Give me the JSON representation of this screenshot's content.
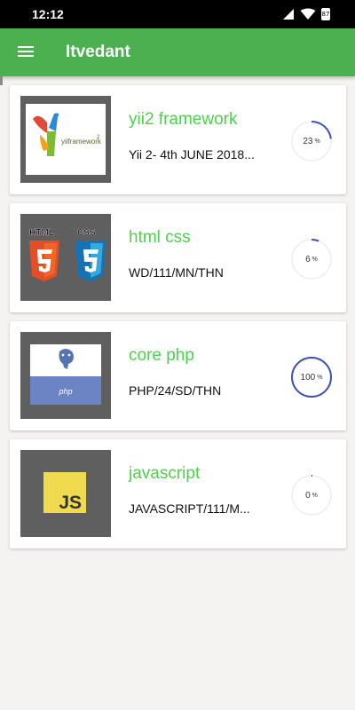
{
  "status_bar": {
    "time": "12:12",
    "battery": "87"
  },
  "app_bar": {
    "title": "Itvedant"
  },
  "colors": {
    "accent": "#4caf50",
    "title_green": "#4cd14c",
    "progress": "#3f51b5"
  },
  "courses": [
    {
      "title": "yii2 framework",
      "code": "Yii 2- 4th JUNE 2018...",
      "progress": 23,
      "unit": "%",
      "icon": "yii-framework-logo",
      "logo_text": "yiiframework"
    },
    {
      "title": "html css",
      "code": "WD/111/MN/THN",
      "progress": 6,
      "unit": "%",
      "icon": "html5-css3-logo",
      "logo_html": "HTML",
      "logo_css": "CSS"
    },
    {
      "title": "core php",
      "code": "PHP/24/SD/THN",
      "progress": 100,
      "unit": "%",
      "icon": "php-logo",
      "logo_text": "php"
    },
    {
      "title": "javascript",
      "code": "JAVASCRIPT/111/M...",
      "progress": 0,
      "unit": "%",
      "icon": "javascript-logo",
      "logo_text": "JS"
    }
  ]
}
